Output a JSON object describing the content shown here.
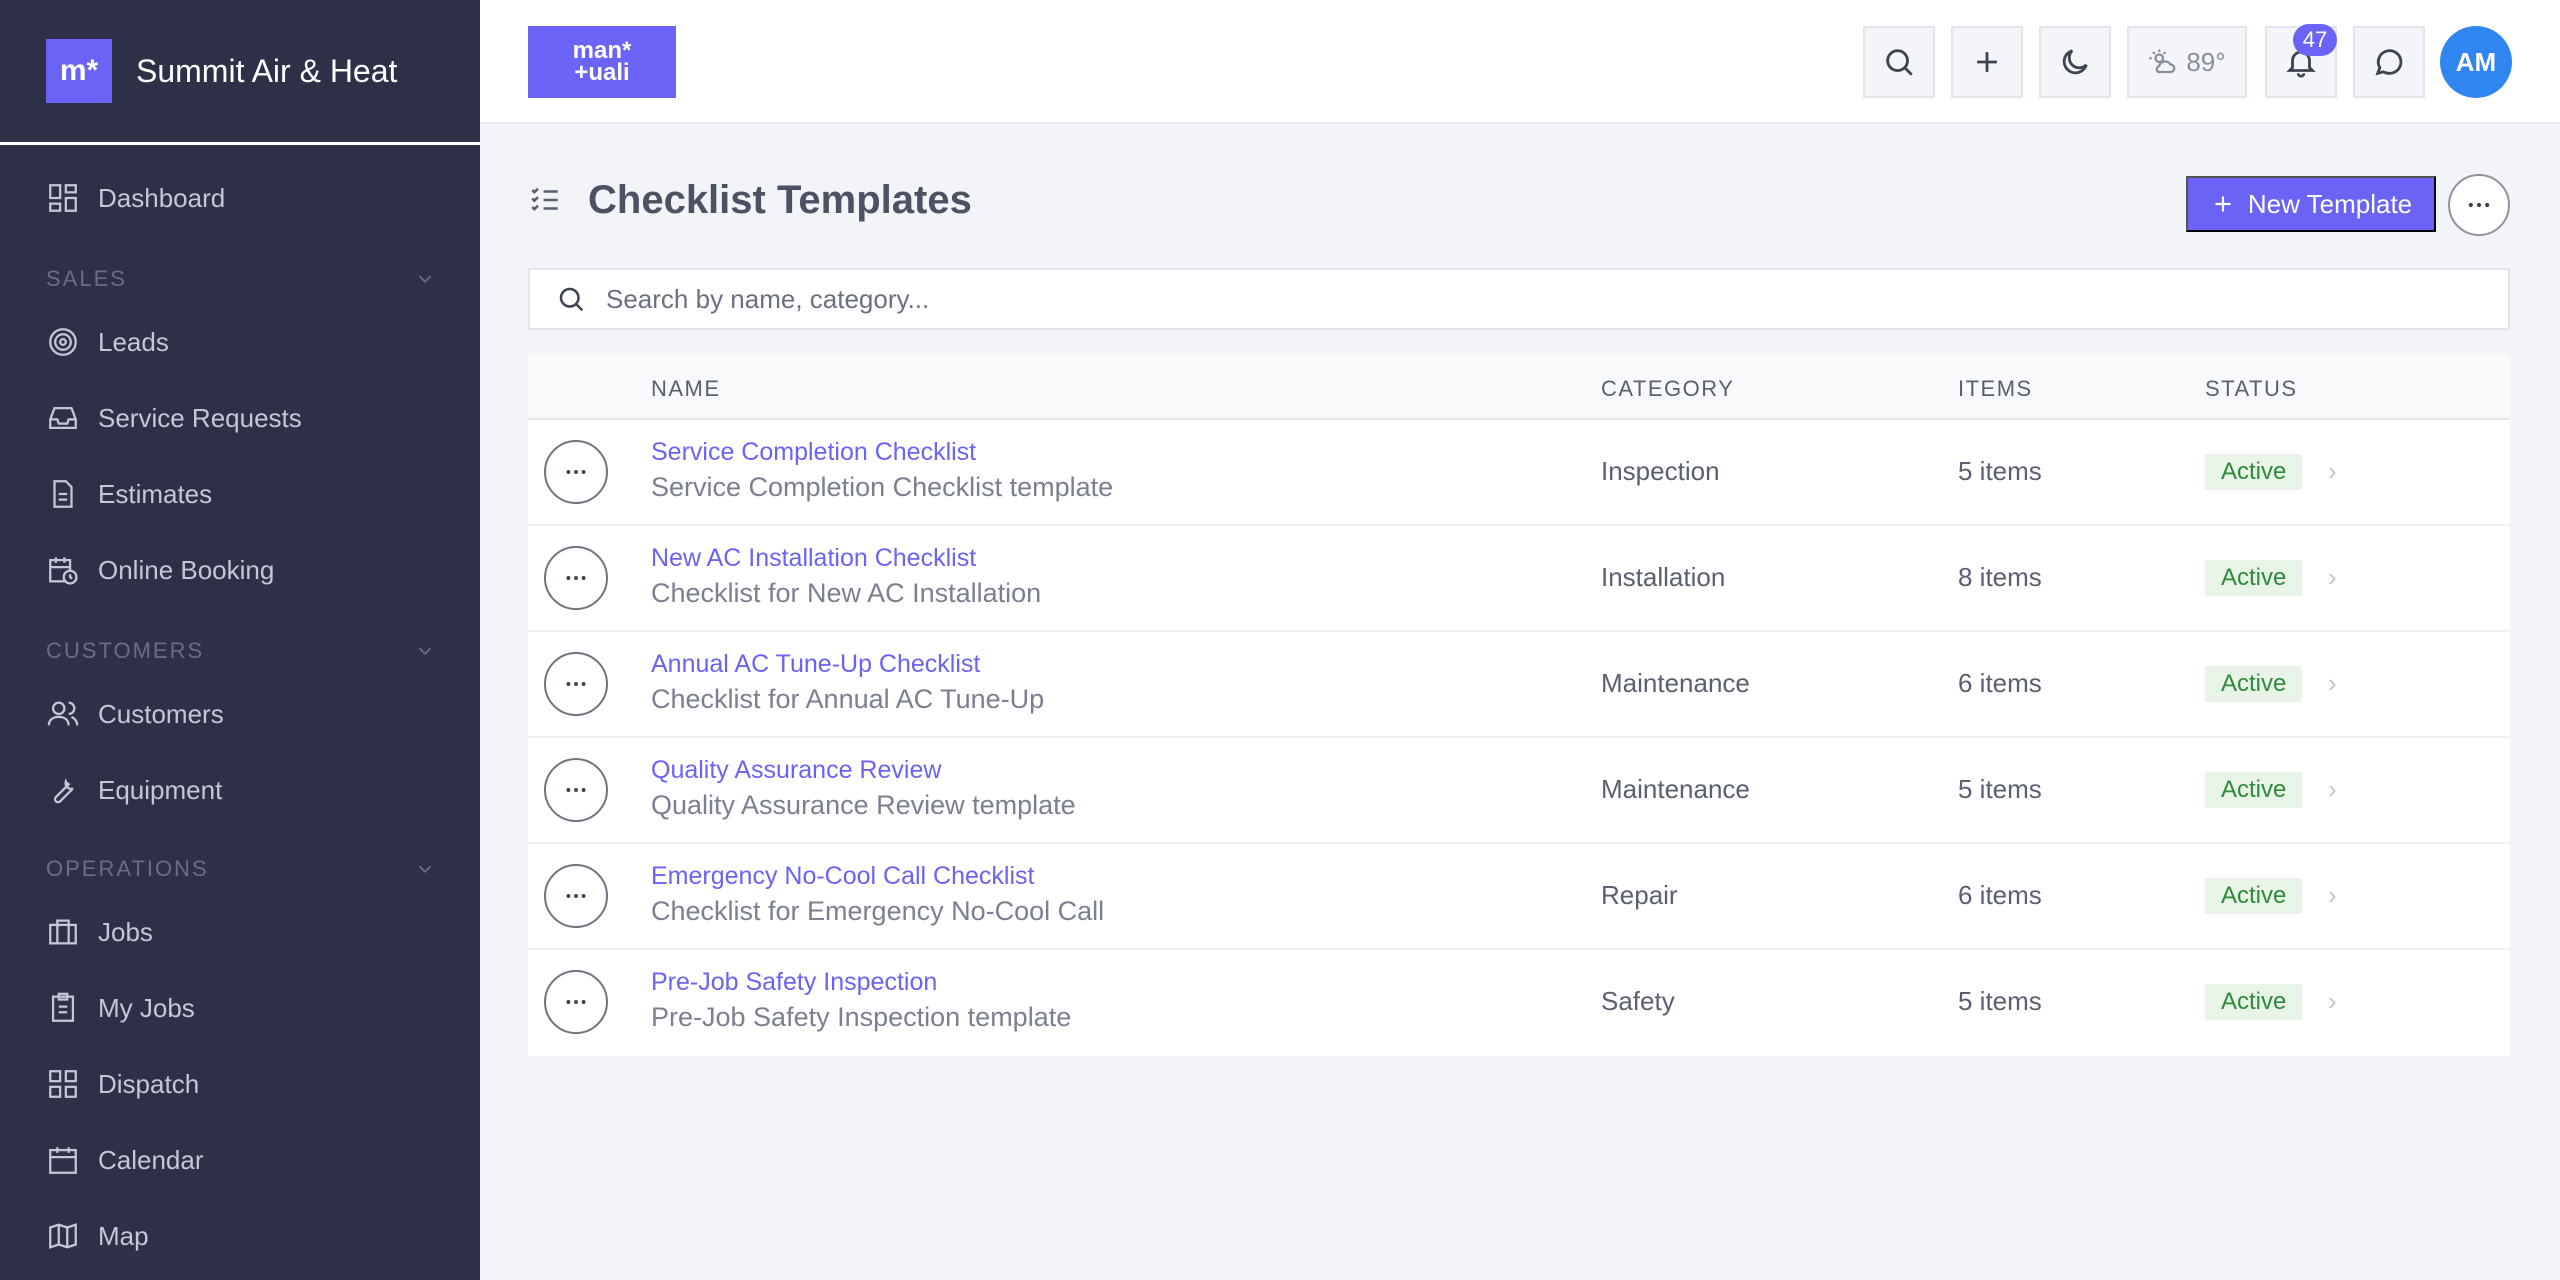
{
  "sidebar": {
    "brand_logo": "m*",
    "brand_name": "Summit Air & Heat",
    "items": {
      "dashboard": "Dashboard",
      "leads": "Leads",
      "service_requests": "Service Requests",
      "estimates": "Estimates",
      "online_booking": "Online Booking",
      "customers": "Customers",
      "equipment": "Equipment",
      "jobs": "Jobs",
      "my_jobs": "My Jobs",
      "dispatch": "Dispatch",
      "calendar": "Calendar",
      "map": "Map"
    },
    "sections": {
      "sales": "SALES",
      "customers": "CUSTOMERS",
      "operations": "OPERATIONS"
    }
  },
  "header": {
    "logo_line1": "man*",
    "logo_line2": "+uali",
    "weather": "89°",
    "notification_count": "47",
    "avatar_initials": "AM"
  },
  "page": {
    "title": "Checklist Templates",
    "new_button": "New Template",
    "search_placeholder": "Search by name, category..."
  },
  "table": {
    "columns": {
      "name": "NAME",
      "category": "CATEGORY",
      "items": "ITEMS",
      "status": "STATUS"
    },
    "rows": [
      {
        "name": "Service Completion Checklist",
        "description": "Service Completion Checklist template",
        "category": "Inspection",
        "items": "5 items",
        "status": "Active"
      },
      {
        "name": "New AC Installation Checklist",
        "description": "Checklist for New AC Installation",
        "category": "Installation",
        "items": "8 items",
        "status": "Active"
      },
      {
        "name": "Annual AC Tune-Up Checklist",
        "description": "Checklist for Annual AC Tune-Up",
        "category": "Maintenance",
        "items": "6 items",
        "status": "Active"
      },
      {
        "name": "Quality Assurance Review",
        "description": "Quality Assurance Review template",
        "category": "Maintenance",
        "items": "5 items",
        "status": "Active"
      },
      {
        "name": "Emergency No-Cool Call Checklist",
        "description": "Checklist for Emergency No-Cool Call",
        "category": "Repair",
        "items": "6 items",
        "status": "Active"
      },
      {
        "name": "Pre-Job Safety Inspection",
        "description": "Pre-Job Safety Inspection template",
        "category": "Safety",
        "items": "5 items",
        "status": "Active"
      }
    ]
  },
  "colors": {
    "sidebar_bg": "#2e3048",
    "accent": "#6a63f6",
    "status_active_bg": "#e8f4e8",
    "status_active_text": "#2f8a3a",
    "avatar_bg": "#2f86f0"
  }
}
